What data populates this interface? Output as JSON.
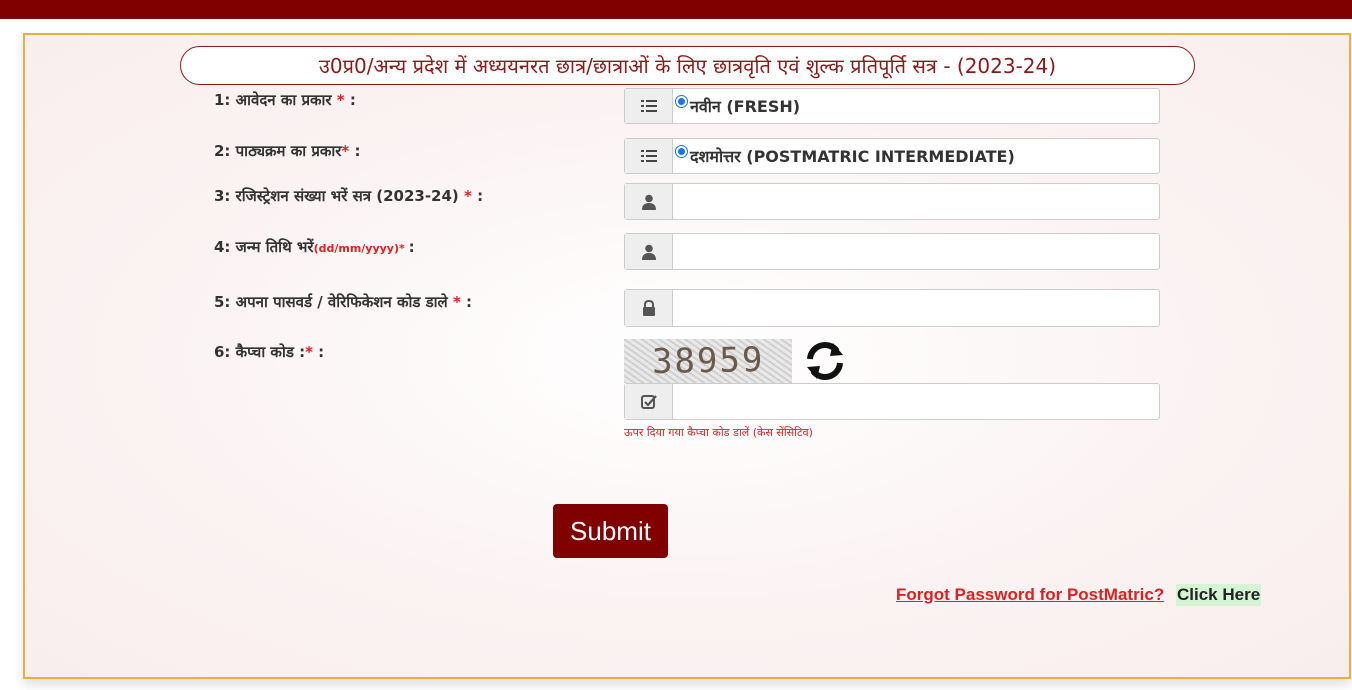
{
  "header": {
    "title": "उ0प्र0/अन्य प्रदेश में अध्ययनरत छात्र/छात्राओं के लिए छात्रवृति एवं शुल्क प्रतिपूर्ति सत्र - (2023-24)"
  },
  "form": {
    "application_type": {
      "label": "1: आवेदन का प्रकार",
      "required_mark": " * ",
      "suffix": ":",
      "option": "नवीन (FRESH)",
      "icon": "list-icon"
    },
    "course_type": {
      "label": "2: पाठ्यक्रम का प्रकार",
      "required_mark": "*",
      "suffix": " :",
      "option": "दशमोत्तर (POSTMATRIC INTERMEDIATE)",
      "icon": "list-icon"
    },
    "registration": {
      "label": "3: रजिस्ट्रेशन संख्या भरें सत्र (2023-24)",
      "required_mark": " * ",
      "suffix": ":",
      "value": "",
      "icon": "user-icon"
    },
    "dob": {
      "label": "4: जन्म तिथि भरें",
      "hint": "(dd/mm/yyyy)",
      "required_mark": "* ",
      "suffix": ":",
      "value": "",
      "icon": "user-icon"
    },
    "password": {
      "label": "5: अपना पासवर्ड / वेरिफिकेशन कोड डाले",
      "required_mark": " * ",
      "suffix": ":",
      "value": "",
      "icon": "lock-icon"
    },
    "captcha": {
      "label": "6: कैप्चा कोड :",
      "required_mark": "* ",
      "suffix": ":",
      "code": "38959",
      "value": "",
      "hint": "ऊपर दिया गया कैप्चा कोड डालें (केस सेंसिटिव)",
      "icon": "check-icon"
    },
    "submit_label": "Submit"
  },
  "footer": {
    "forgot_text": "Forgot Password for PostMatric?",
    "click_here": "Click Here"
  },
  "colors": {
    "brand": "#800000",
    "required": "#e02020",
    "panel_border": "#e8b040"
  }
}
